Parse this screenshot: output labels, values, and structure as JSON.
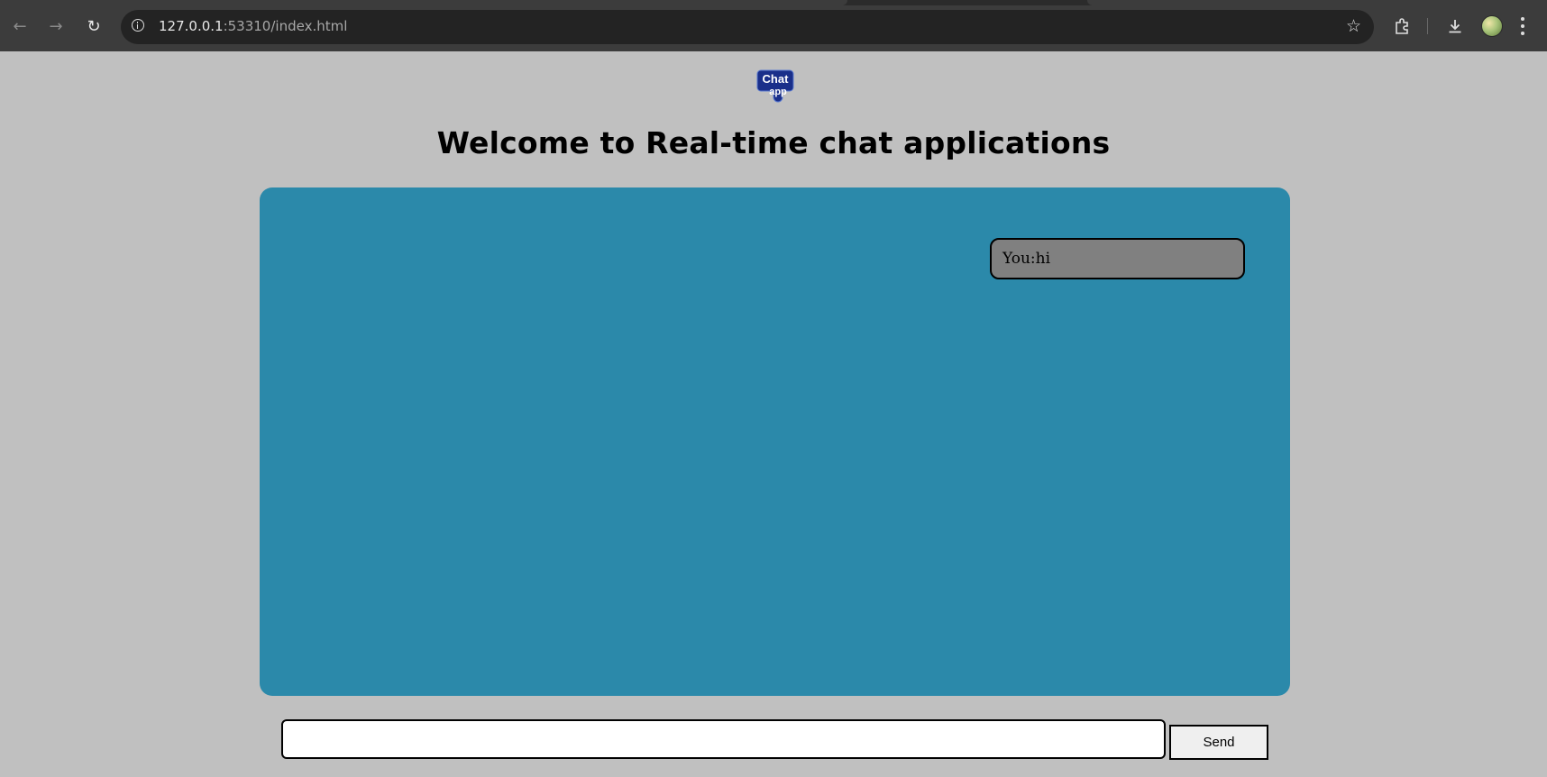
{
  "browser": {
    "url_host": "127.0.0.1",
    "url_rest": ":53310/index.html",
    "icons": {
      "back": "back-arrow-icon",
      "forward": "forward-arrow-icon",
      "reload": "reload-icon",
      "site_info": "info-icon",
      "bookmark": "star-icon",
      "extensions": "puzzle-icon",
      "downloads": "download-icon",
      "profile": "avatar",
      "menu": "kebab-menu-icon"
    }
  },
  "page": {
    "logo": {
      "line1": "Chat",
      "line2": "app",
      "color": "#1a2f8a"
    },
    "title": "Welcome to Real-time chat applications",
    "colors": {
      "background": "#c0c0c0",
      "chat_window": "#2b89aa",
      "bubble": "#808080"
    }
  },
  "chat": {
    "messages": [
      {
        "text": "You:hi"
      }
    ]
  },
  "composer": {
    "input_value": "",
    "send_label": "Send"
  }
}
